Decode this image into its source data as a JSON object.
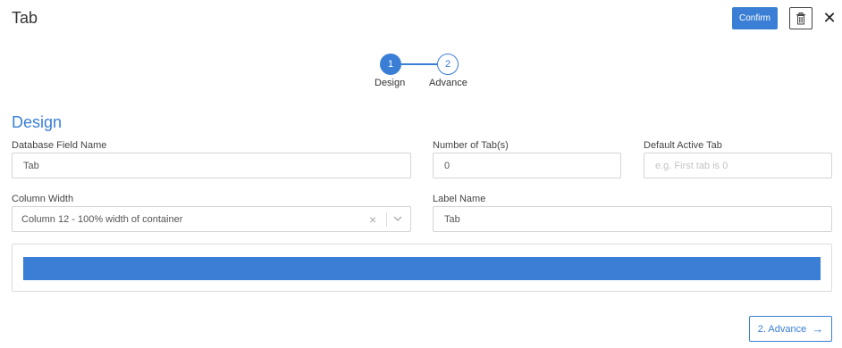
{
  "header": {
    "title": "Tab",
    "confirm_label": "Confirm",
    "close_glyph": "✕"
  },
  "stepper": {
    "steps": [
      {
        "number": "1",
        "label": "Design",
        "active": true
      },
      {
        "number": "2",
        "label": "Advance",
        "active": false
      }
    ]
  },
  "section": {
    "title": "Design"
  },
  "fields": {
    "db_field_name": {
      "label": "Database Field Name",
      "value": "Tab"
    },
    "num_tabs": {
      "label": "Number of Tab(s)",
      "value": "0"
    },
    "default_active": {
      "label": "Default Active Tab",
      "placeholder": "e.g. First tab is 0"
    },
    "column_width": {
      "label": "Column Width",
      "value": "Column 12 - 100% width of container"
    },
    "label_name": {
      "label": "Label Name",
      "value": "Tab"
    }
  },
  "footer": {
    "advance_label": "2. Advance",
    "arrow_glyph": "→"
  },
  "colors": {
    "accent": "#3a7fd5"
  },
  "icons": {
    "trash": "trash-icon",
    "close": "close-icon",
    "clear": "clear-icon",
    "chevron": "chevron-down-icon",
    "arrow": "arrow-right-icon"
  }
}
